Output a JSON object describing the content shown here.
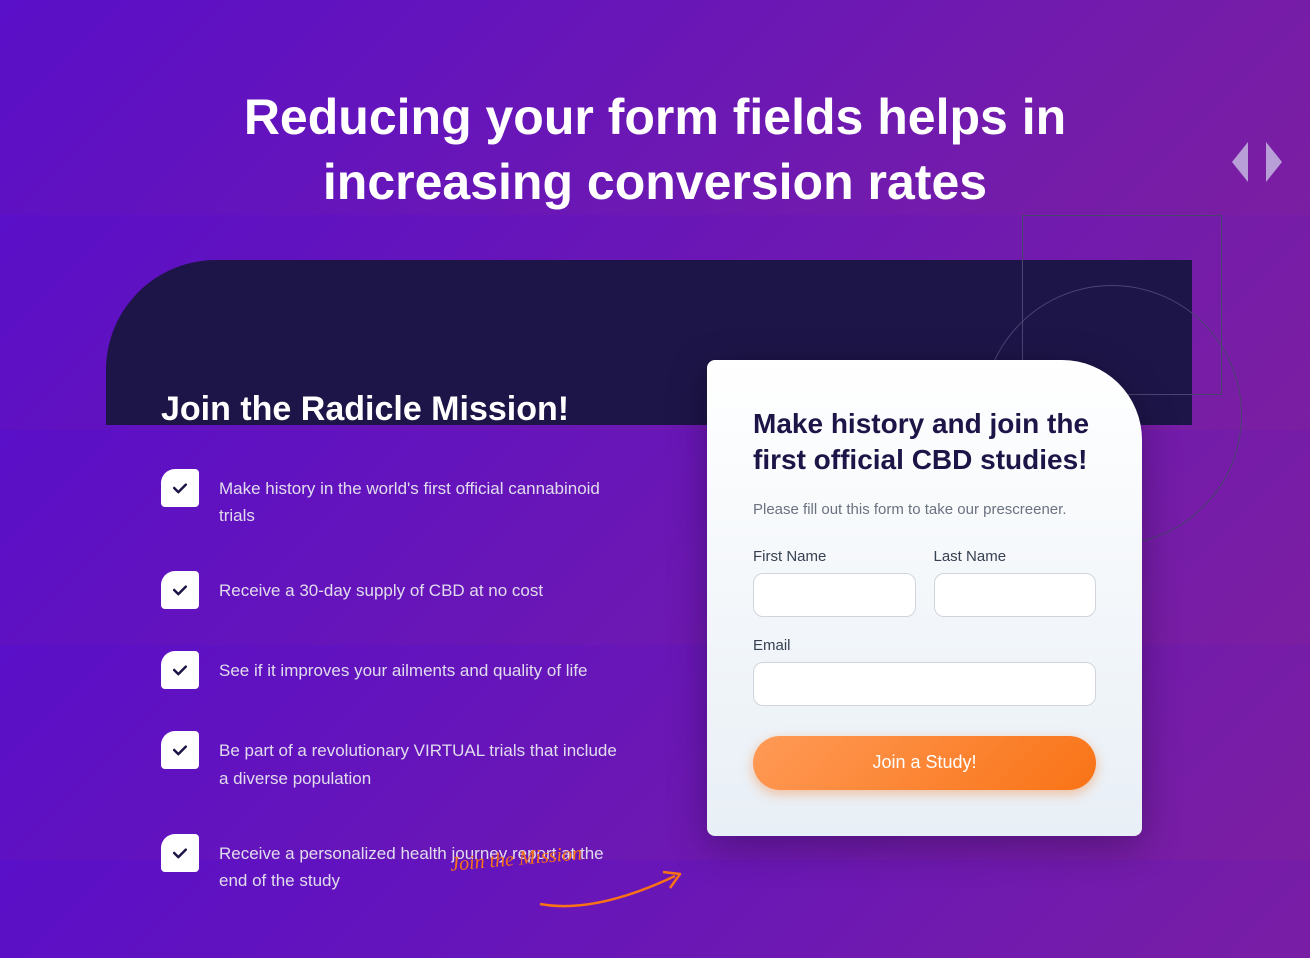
{
  "header": {
    "title": "Reducing your form fields helps in increasing conversion rates"
  },
  "left": {
    "heading": "Join the Radicle Mission!",
    "bullets": [
      "Make history in the world's first official cannabinoid trials",
      "Receive a 30-day supply of CBD at no cost",
      "See if it improves your ailments and quality of life",
      "Be part of a revolutionary VIRTUAL trials that include a diverse population",
      "Receive a personalized health journey report at the end of the study"
    ]
  },
  "form": {
    "heading": "Make history and join the first official CBD studies!",
    "subtext": "Please fill out this form to take our prescreener.",
    "fields": {
      "first_name_label": "First Name",
      "last_name_label": "Last Name",
      "email_label": "Email"
    },
    "submit_label": "Join a Study!"
  },
  "annotation": {
    "text": "Join the Mission"
  },
  "colors": {
    "bg_gradient_start": "#5a0fc8",
    "bg_gradient_end": "#7b1fa2",
    "card_bg": "#1d1548",
    "accent": "#f97316"
  }
}
